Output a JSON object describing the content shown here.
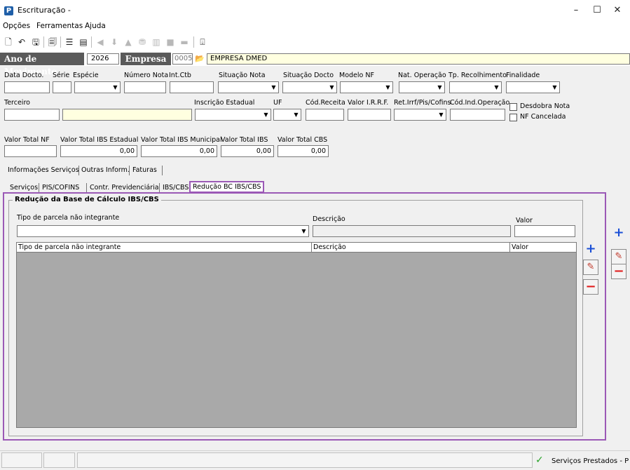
{
  "window": {
    "title": "Escrituração -",
    "app_icon": "P",
    "minimize": "–",
    "maximize": "☐",
    "close": "✕"
  },
  "menu": [
    "Opções",
    "Ferramentas",
    "Ajuda"
  ],
  "movimento": {
    "ano_label": "Ano de Movimento",
    "ano_value": "2026",
    "empresa_label": "Empresa",
    "empresa_code": "0005",
    "empresa_name": "EMPRESA DMED"
  },
  "form": {
    "row1_labels": [
      "Data Docto.",
      "Série",
      "Espécie",
      "Número Nota",
      "Int.Ctb",
      "Situação Nota",
      "Situação Docto",
      "Modelo NF",
      "Nat. Operação",
      "Tp. Recolhimento",
      "Finalidade"
    ],
    "row2_labels": [
      "Terceiro",
      "Inscrição Estadual",
      "UF",
      "Cód.Receita",
      "Valor I.R.R.F.",
      "Ret.Irrf/Pis/Cofins",
      "Cód.Ind.Operação"
    ],
    "checkboxes": [
      "Desdobra Nota",
      "NF Cancelada"
    ],
    "totals": [
      {
        "label": "Valor Total NF",
        "value": ""
      },
      {
        "label": "Valor Total IBS Estadual",
        "value": "0,00"
      },
      {
        "label": "Valor Total IBS Municipal",
        "value": "0,00"
      },
      {
        "label": "Valor Total IBS",
        "value": "0,00"
      },
      {
        "label": "Valor Total CBS",
        "value": "0,00"
      }
    ]
  },
  "tabs_main": [
    "Informações Serviços",
    "Outras Inform.",
    "Faturas"
  ],
  "tabs_sub": [
    "Serviços",
    "PIS/COFINS",
    "Contr. Previdenciária",
    "IBS/CBS",
    "Redução BC IBS/CBS"
  ],
  "group": {
    "title": "Redução da Base de Cálculo IBS/CBS",
    "field_labels": {
      "tipo": "Tipo de parcela não integrante",
      "descricao": "Descrição",
      "valor": "Valor"
    },
    "grid_headers": [
      "Tipo de parcela não integrante",
      "Descrição",
      "Valor"
    ]
  },
  "buttons": {
    "add": "+",
    "edit": "✎",
    "remove": "−"
  },
  "status": {
    "text": "Serviços Prestados - P"
  },
  "colors": {
    "accent_frame": "#9b59b6",
    "label_bg": "#5a5a5a",
    "yellow_field": "#ffffe0",
    "grid_bg": "#a9a9a9",
    "add": "#1a4fd6",
    "remove": "#e01b1b"
  }
}
